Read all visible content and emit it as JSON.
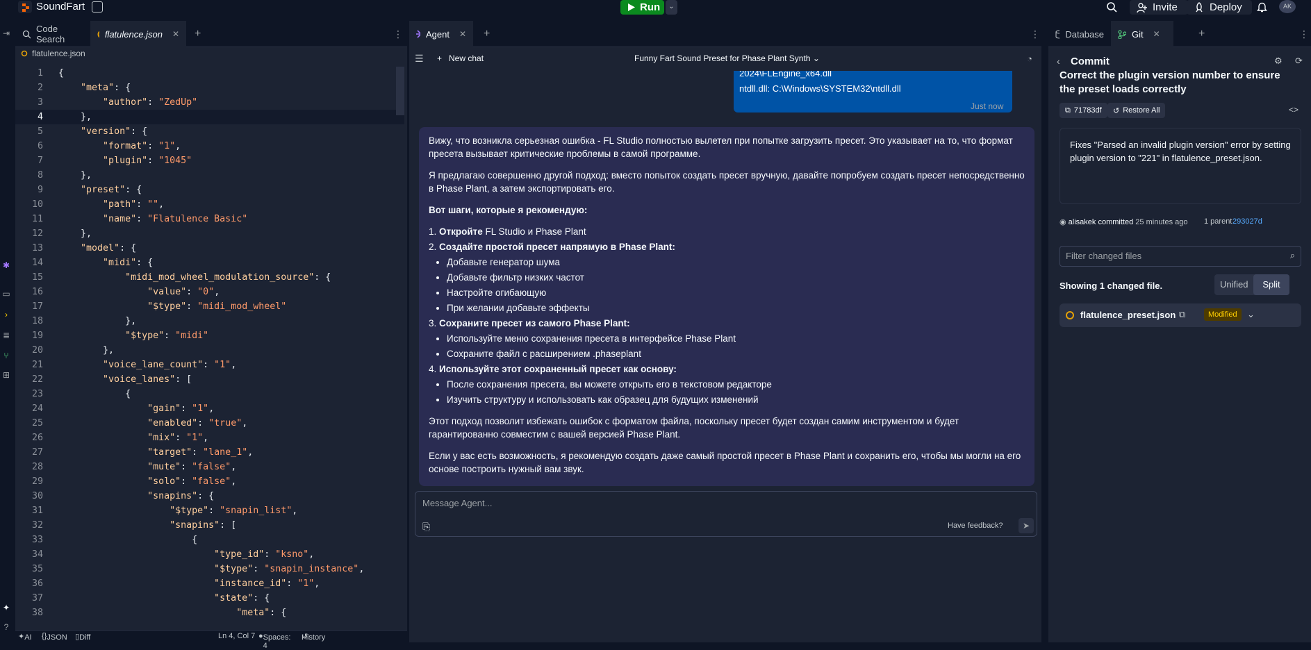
{
  "topbar": {
    "app_name": "SoundFart",
    "run_label": "Run",
    "invite_label": "Invite",
    "deploy_label": "Deploy",
    "avatar_initials": "AK"
  },
  "editor": {
    "tabs": [
      {
        "label": "Code Search"
      },
      {
        "label": "flatulence.json"
      }
    ],
    "breadcrumb": "flatulence.json",
    "lines": [
      {
        "n": "1",
        "t": "{"
      },
      {
        "n": "2",
        "t": "    \"meta\": {"
      },
      {
        "n": "3",
        "t": "        \"author\": \"ZedUp\""
      },
      {
        "n": "4",
        "t": "    },"
      },
      {
        "n": "5",
        "t": "    \"version\": {"
      },
      {
        "n": "6",
        "t": "        \"format\": \"1\","
      },
      {
        "n": "7",
        "t": "        \"plugin\": \"1045\""
      },
      {
        "n": "8",
        "t": "    },"
      },
      {
        "n": "9",
        "t": "    \"preset\": {"
      },
      {
        "n": "10",
        "t": "        \"path\": \"\","
      },
      {
        "n": "11",
        "t": "        \"name\": \"Flatulence Basic\""
      },
      {
        "n": "12",
        "t": "    },"
      },
      {
        "n": "13",
        "t": "    \"model\": {"
      },
      {
        "n": "14",
        "t": "        \"midi\": {"
      },
      {
        "n": "15",
        "t": "            \"midi_mod_wheel_modulation_source\": {"
      },
      {
        "n": "16",
        "t": "                \"value\": \"0\","
      },
      {
        "n": "17",
        "t": "                \"$type\": \"midi_mod_wheel\""
      },
      {
        "n": "18",
        "t": "            },"
      },
      {
        "n": "19",
        "t": "            \"$type\": \"midi\""
      },
      {
        "n": "20",
        "t": "        },"
      },
      {
        "n": "21",
        "t": "        \"voice_lane_count\": \"1\","
      },
      {
        "n": "22",
        "t": "        \"voice_lanes\": ["
      },
      {
        "n": "23",
        "t": "            {"
      },
      {
        "n": "24",
        "t": "                \"gain\": \"1\","
      },
      {
        "n": "25",
        "t": "                \"enabled\": \"true\","
      },
      {
        "n": "26",
        "t": "                \"mix\": \"1\","
      },
      {
        "n": "27",
        "t": "                \"target\": \"lane_1\","
      },
      {
        "n": "28",
        "t": "                \"mute\": \"false\","
      },
      {
        "n": "29",
        "t": "                \"solo\": \"false\","
      },
      {
        "n": "30",
        "t": "                \"snapins\": {"
      },
      {
        "n": "31",
        "t": "                    \"$type\": \"snapin_list\","
      },
      {
        "n": "32",
        "t": "                    \"snapins\": ["
      },
      {
        "n": "33",
        "t": "                        {"
      },
      {
        "n": "34",
        "t": "                            \"type_id\": \"ksno\","
      },
      {
        "n": "35",
        "t": "                            \"$type\": \"snapin_instance\","
      },
      {
        "n": "36",
        "t": "                            \"instance_id\": \"1\","
      },
      {
        "n": "37",
        "t": "                            \"state\": {"
      },
      {
        "n": "38",
        "t": "                                \"meta\": {"
      }
    ],
    "status": {
      "ai": "AI",
      "lang": "JSON",
      "diff": "Diff",
      "position": "Ln 4, Col 7",
      "spaces": "Spaces: 4",
      "history": "History"
    }
  },
  "agent": {
    "tab_label": "Agent",
    "new_chat_label": "New chat",
    "chat_title": "Funny Fart Sound Preset for Phase Plant Synth",
    "user_msg_line1": "2024\\FLEngine_x64.dll",
    "user_msg_line2": "ntdll.dll: C:\\Windows\\SYSTEM32\\ntdll.dll",
    "timestamp": "Just now",
    "reply": {
      "p1": "Вижу, что возникла серьезная ошибка - FL Studio полностью вылетел при попытке загрузить пресет. Это указывает на то, что формат пресета вызывает критические проблемы в самой программе.",
      "p2": "Я предлагаю совершенно другой подход: вместо попыток создать пресет вручную, давайте попробуем создать пресет непосредственно в Phase Plant, а затем экспортировать его.",
      "steps_heading": "Вот шаги, которые я рекомендую:",
      "s1_bold": "Откройте",
      "s1_rest": " FL Studio и Phase Plant",
      "s2_bold": "Создайте простой пресет напрямую в",
      "s2_rest": " Phase Plant:",
      "s2_items": [
        "Добавьте генератор шума",
        "Добавьте фильтр низких частот",
        "Настройте огибающую",
        "При желании добавьте эффекты"
      ],
      "s3_bold": "Сохраните пресет из самого",
      "s3_rest": " Phase Plant:",
      "s3_items": [
        "Используйте меню сохранения пресета в интерфейсе Phase Plant",
        "Сохраните файл с расширением .phaseplant"
      ],
      "s4_bold": "Используйте этот сохраненный пресет как основу:",
      "s4_items": [
        "После сохранения пресета, вы можете открыть его в текстовом редакторе",
        "Изучить структуру и использовать как образец для будущих изменений"
      ],
      "p3": "Этот подход позволит избежать ошибок с форматом файла, поскольку пресет будет создан самим инструментом и будет гарантированно совместим с вашей версией Phase Plant.",
      "p4": "Если у вас есть возможность, я рекомендую создать даже самый простой пресет в Phase Plant и сохранить его, чтобы мы могли на его основе построить нужный вам звук."
    },
    "compose_placeholder": "Message Agent...",
    "feedback_label": "Have feedback?"
  },
  "git": {
    "tabs": [
      {
        "label": "Database"
      },
      {
        "label": "Git"
      }
    ],
    "header": "Commit",
    "commit_title": "Correct the plugin version number to ensure the preset loads correctly",
    "hash": "71783df",
    "restore_label": "Restore All",
    "description": "Fixes \"Parsed an invalid plugin version\" error by setting plugin version to \"221\" in flatulence_preset.json.",
    "author": "alisakek",
    "committed_word": "committed",
    "time_ago": "25 minutes ago",
    "parent_label": "1 parent",
    "parent_hash": "293027d",
    "filter_placeholder": "Filter changed files",
    "showing_text": "Showing 1 changed file.",
    "unified_label": "Unified",
    "split_label": "Split",
    "file_name": "flatulence_preset.json",
    "file_status": "Modified"
  }
}
